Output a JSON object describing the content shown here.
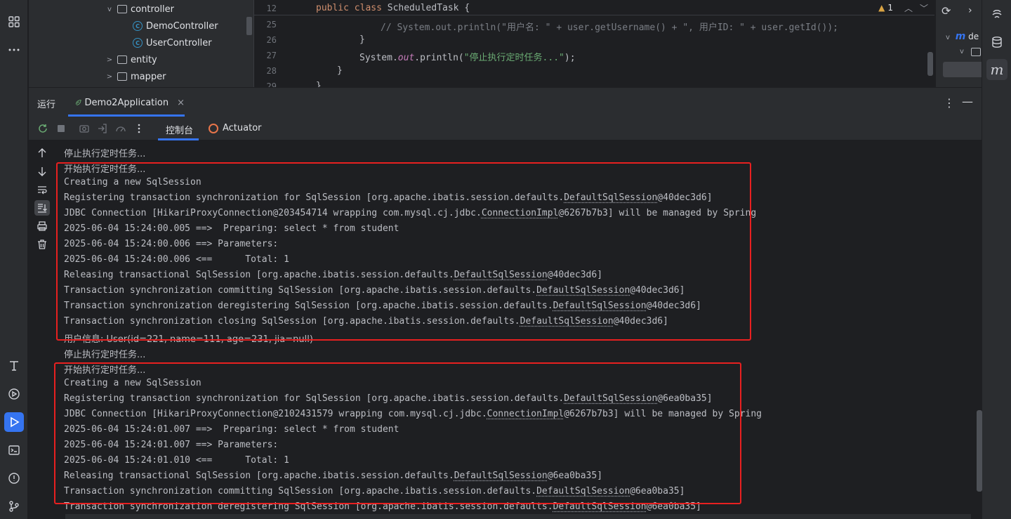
{
  "project_tree": {
    "items": [
      {
        "label": "controller",
        "kind": "folder",
        "chevron": "v"
      },
      {
        "label": "DemoController",
        "kind": "class",
        "chevron": ""
      },
      {
        "label": "UserController",
        "kind": "class",
        "chevron": ""
      },
      {
        "label": "entity",
        "kind": "folder",
        "chevron": ">"
      },
      {
        "label": "mapper",
        "kind": "folder",
        "chevron": ">"
      }
    ]
  },
  "editor": {
    "sticky_line_number": "12",
    "sticky_kw": "public class",
    "sticky_rest": " ScheduledTask {",
    "warning_count": "1",
    "lines": [
      {
        "num": "25",
        "comment": "// System.out.println(\"用户名: \" + user.getUsername() + \", 用户ID: \" + user.getId());"
      },
      {
        "num": "26",
        "text": "}"
      },
      {
        "num": "27",
        "pre": "System.",
        "field": "out",
        "mid": ".println(",
        "str": "\"停止执行定时任务...\"",
        "post": ");"
      },
      {
        "num": "28",
        "text": "}"
      },
      {
        "num": "29",
        "text": "}"
      }
    ]
  },
  "structure": {
    "chev": "v",
    "label": "de",
    "m_glyph": "m"
  },
  "run_panel": {
    "title": "运行",
    "tab_label": "Demo2Application",
    "tab_close": "×",
    "console_tab": "控制台",
    "actuator_tab": "Actuator"
  },
  "console_lines": [
    {
      "text": "停止执行定时任务...",
      "cjk": true
    },
    {
      "text": "开始执行定时任务...",
      "cjk": true
    },
    {
      "text": "Creating a new SqlSession"
    },
    {
      "pre": "Registering transaction synchronization for SqlSession [org.apache.ibatis.session.defaults.",
      "cls": "DefaultSqlSession",
      "post": "@40dec3d6]"
    },
    {
      "pre": "JDBC Connection [HikariProxyConnection@203454714 wrapping com.mysql.cj.jdbc.",
      "cls": "ConnectionImpl",
      "post": "@6267b7b3] will be managed by Spring"
    },
    {
      "text": "2025-06-04 15:24:00.005 ==>  Preparing: select * from student"
    },
    {
      "text": "2025-06-04 15:24:00.006 ==> Parameters: "
    },
    {
      "text": "2025-06-04 15:24:00.006 <==      Total: 1"
    },
    {
      "pre": "Releasing transactional SqlSession [org.apache.ibatis.session.defaults.",
      "cls": "DefaultSqlSession",
      "post": "@40dec3d6]"
    },
    {
      "pre": "Transaction synchronization committing SqlSession [org.apache.ibatis.session.defaults.",
      "cls": "DefaultSqlSession",
      "post": "@40dec3d6]"
    },
    {
      "pre": "Transaction synchronization deregistering SqlSession [org.apache.ibatis.session.defaults.",
      "cls": "DefaultSqlSession",
      "post": "@40dec3d6]"
    },
    {
      "pre": "Transaction synchronization closing SqlSession [org.apache.ibatis.session.defaults.",
      "cls": "DefaultSqlSession",
      "post": "@40dec3d6]"
    },
    {
      "text": "用户信息: User(id=221, name=111, age=231, jia=null)",
      "cjk": true
    },
    {
      "text": "停止执行定时任务...",
      "cjk": true
    },
    {
      "text": "开始执行定时任务...",
      "cjk": true
    },
    {
      "text": "Creating a new SqlSession"
    },
    {
      "pre": "Registering transaction synchronization for SqlSession [org.apache.ibatis.session.defaults.",
      "cls": "DefaultSqlSession",
      "post": "@6ea0ba35]"
    },
    {
      "pre": "JDBC Connection [HikariProxyConnection@2102431579 wrapping com.mysql.cj.jdbc.",
      "cls": "ConnectionImpl",
      "post": "@6267b7b3] will be managed by Spring"
    },
    {
      "text": "2025-06-04 15:24:01.007 ==>  Preparing: select * from student"
    },
    {
      "text": "2025-06-04 15:24:01.007 ==> Parameters: "
    },
    {
      "text": "2025-06-04 15:24:01.010 <==      Total: 1"
    },
    {
      "pre": "Releasing transactional SqlSession [org.apache.ibatis.session.defaults.",
      "cls": "DefaultSqlSession",
      "post": "@6ea0ba35]"
    },
    {
      "pre": "Transaction synchronization committing SqlSession [org.apache.ibatis.session.defaults.",
      "cls": "DefaultSqlSession",
      "post": "@6ea0ba35]"
    },
    {
      "pre": "Transaction synchronization deregistering SqlSession [org.apache.ibatis.session.defaults.",
      "cls": "DefaultSqlSession",
      "post": "@6ea0ba35]"
    }
  ],
  "colors": {
    "accent": "#3574f0",
    "highlight_box": "#e82020",
    "string": "#6aab73",
    "keyword": "#cf8e6d"
  }
}
